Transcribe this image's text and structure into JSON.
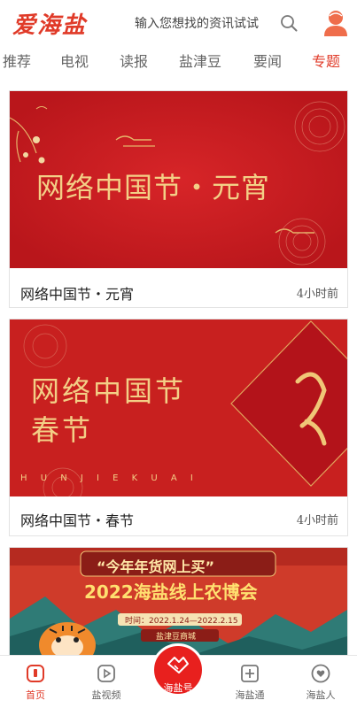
{
  "header": {
    "logo": "爱海盐",
    "search_placeholder": "输入您想找的资讯试试"
  },
  "tabs": [
    "推荐",
    "电视",
    "读报",
    "盐津豆",
    "要闻",
    "专题"
  ],
  "active_tab": "专题",
  "cards": [
    {
      "banner_title": "网络中国节・元宵",
      "caption": "网络中国节・元宵",
      "time": "4小时前"
    },
    {
      "banner_title_line1": "网络中国节",
      "banner_title_line2": "春节",
      "banner_subtitle": "H U N J I E K U A I",
      "caption": "网络中国节・春节",
      "time": "4小时前"
    },
    {
      "banner_title_line1": "“今年年货网上买”",
      "banner_title_line2": "2022海盐线上农博会",
      "banner_dates": "时间：2022.1.24—2022.2.15",
      "banner_tag": "盐津豆商城"
    }
  ],
  "bottom_nav": {
    "items": [
      "首页",
      "盐视频",
      "海盐号",
      "海盐通",
      "海盐人"
    ],
    "active": "首页"
  },
  "colors": {
    "brand_red": "#e03a28",
    "banner_red": "#c41d1f",
    "gold": "#f3cf86"
  }
}
